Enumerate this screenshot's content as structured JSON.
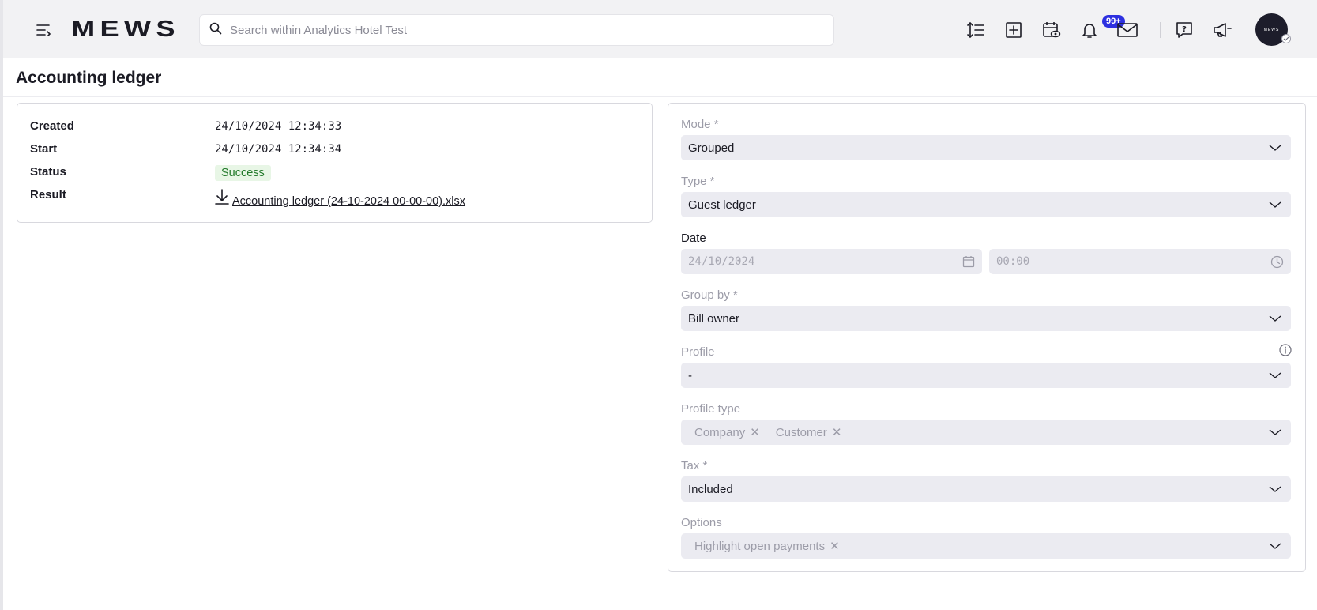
{
  "topbar": {
    "logo": "MEWS",
    "search_placeholder": "Search within Analytics Hotel Test",
    "notifications_badge": "99+",
    "avatar_text": "MEWS"
  },
  "page": {
    "title": "Accounting ledger"
  },
  "details": {
    "created_label": "Created",
    "created_value": "24/10/2024 12:34:33",
    "start_label": "Start",
    "start_value": "24/10/2024 12:34:34",
    "status_label": "Status",
    "status_value": "Success",
    "result_label": "Result",
    "result_file": "Accounting ledger (24-10-2024 00-00-00).xlsx"
  },
  "form": {
    "mode_label": "Mode *",
    "mode_value": "Grouped",
    "type_label": "Type *",
    "type_value": "Guest ledger",
    "date_label": "Date",
    "date_placeholder": "24/10/2024",
    "time_placeholder": "00:00",
    "group_by_label": "Group by *",
    "group_by_value": "Bill owner",
    "profile_label": "Profile",
    "profile_value": "-",
    "profile_type_label": "Profile type",
    "profile_type_chips": [
      "Company",
      "Customer"
    ],
    "tax_label": "Tax *",
    "tax_value": "Included",
    "options_label": "Options",
    "options_chips": [
      "Highlight open payments"
    ]
  },
  "colors": {
    "accent": "#2d30e0",
    "success_bg": "#e8f6e6",
    "success_text": "#237a2b",
    "field_bg": "#ebebf1"
  }
}
